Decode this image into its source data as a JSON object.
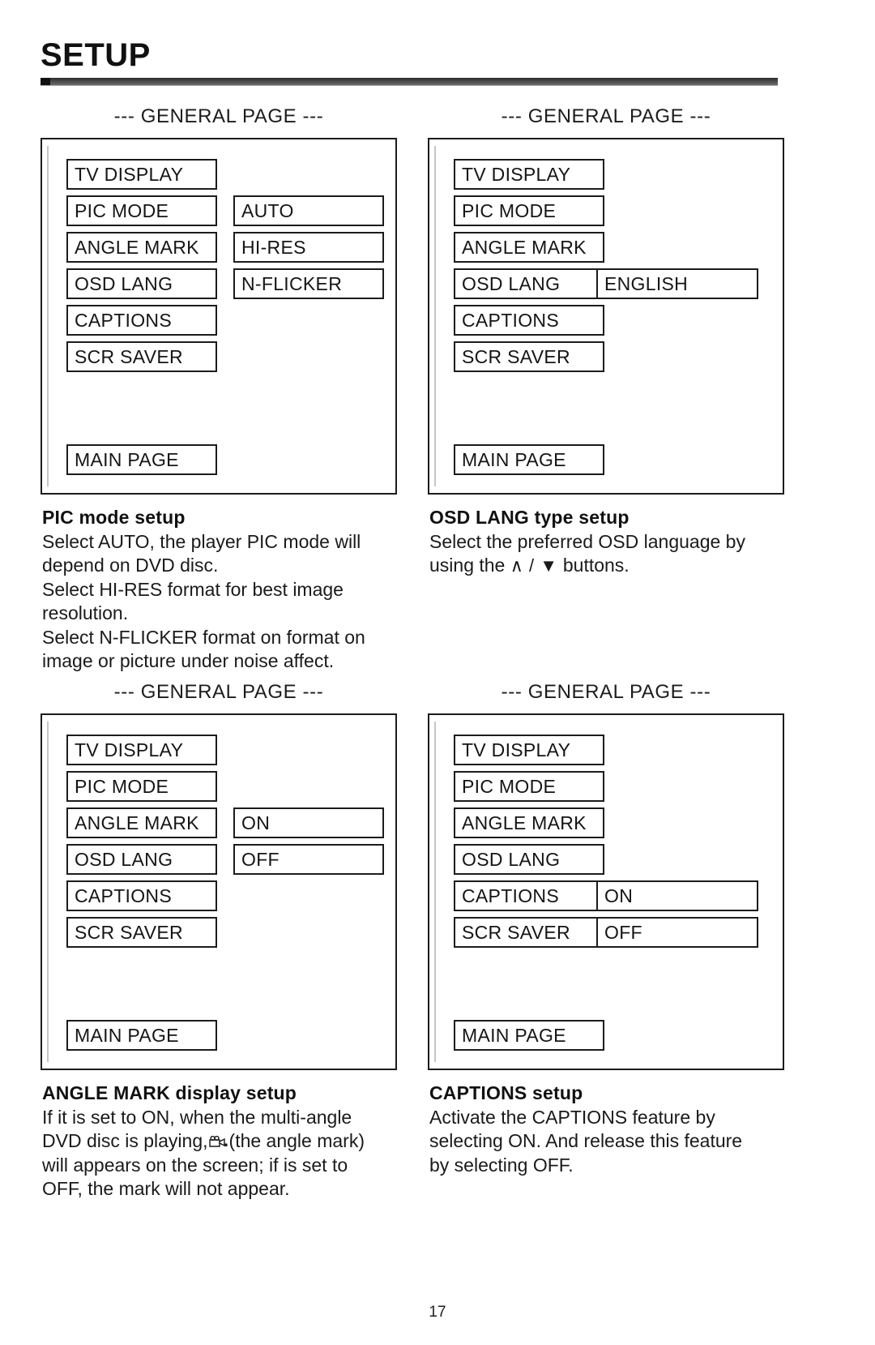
{
  "page": {
    "title": "SETUP",
    "number": "17"
  },
  "figures": [
    {
      "caption": "--- GENERAL PAGE ---",
      "menu_items": [
        "TV DISPLAY",
        "PIC MODE",
        "ANGLE MARK",
        "OSD LANG",
        "CAPTIONS",
        "SCR SAVER"
      ],
      "main_page_label": "MAIN PAGE",
      "options": [
        "AUTO",
        "HI-RES",
        "N-FLICKER"
      ],
      "highlighted_item": "PIC MODE"
    },
    {
      "caption": "--- GENERAL PAGE ---",
      "menu_items": [
        "TV DISPLAY",
        "PIC MODE",
        "ANGLE MARK",
        "OSD LANG",
        "CAPTIONS",
        "SCR SAVER"
      ],
      "main_page_label": "MAIN PAGE",
      "options": [
        "ENGLISH"
      ],
      "highlighted_item": "OSD LANG"
    },
    {
      "caption": "--- GENERAL PAGE ---",
      "menu_items": [
        "TV DISPLAY",
        "PIC MODE",
        "ANGLE MARK",
        "OSD LANG",
        "CAPTIONS",
        "SCR SAVER"
      ],
      "main_page_label": "MAIN PAGE",
      "options": [
        "ON",
        "OFF"
      ],
      "highlighted_item": "ANGLE MARK"
    },
    {
      "caption": "--- GENERAL PAGE ---",
      "menu_items": [
        "TV DISPLAY",
        "PIC MODE",
        "ANGLE MARK",
        "OSD LANG",
        "CAPTIONS",
        "SCR SAVER"
      ],
      "main_page_label": "MAIN PAGE",
      "options": [
        "ON",
        "OFF"
      ],
      "highlighted_item": "CAPTIONS"
    }
  ],
  "descriptions": {
    "pic_mode": {
      "title": "PIC mode setup",
      "lines": [
        "Select AUTO, the player PIC mode will",
        "depend on DVD disc.",
        "Select HI-RES format for best image",
        "resolution.",
        "Select N-FLICKER format on format on",
        "image or picture under noise affect."
      ]
    },
    "osd_lang": {
      "title": "OSD LANG type setup",
      "line1": "Select the preferred OSD language by",
      "line2_prefix": "using the ",
      "line2_arrows": "∧ / ▼",
      "line2_suffix": " buttons."
    },
    "angle_mark": {
      "title": "ANGLE MARK display setup",
      "line1": "If it is set to ON, when the multi-angle",
      "line2_prefix": "DVD disc is playing,",
      "line2_suffix": "(the angle mark)",
      "line3": "will appears on the screen; if is set to",
      "line4": "OFF, the mark will not appear."
    },
    "captions": {
      "title": "CAPTIONS setup",
      "lines": [
        "Activate the CAPTIONS feature by",
        "selecting ON.  And release this feature",
        "by selecting OFF."
      ]
    }
  },
  "colors": {
    "ink": "#1a1a1a",
    "rule": "#2b2b2b",
    "paper": "#ffffff"
  }
}
